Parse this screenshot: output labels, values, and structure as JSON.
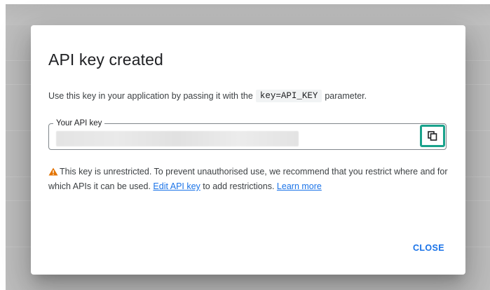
{
  "dialog": {
    "title": "API key created",
    "description_prefix": "Use this key in your application by passing it with the",
    "description_code": "key=API_KEY",
    "description_suffix": "parameter.",
    "field_label": "Your API key",
    "copy_icon": "copy-icon",
    "warning_icon": "warning-icon",
    "warning_color": "#e37400",
    "warning_text": "This key is unrestricted. To prevent unauthorised use, we recommend that you restrict where and for which APIs it can be used.",
    "edit_link": "Edit API key",
    "middle_text": "to add restrictions.",
    "learn_more_link": "Learn more",
    "close_label": "CLOSE",
    "accent_color": "#1a73e8",
    "highlight_color": "#1aa28c"
  }
}
